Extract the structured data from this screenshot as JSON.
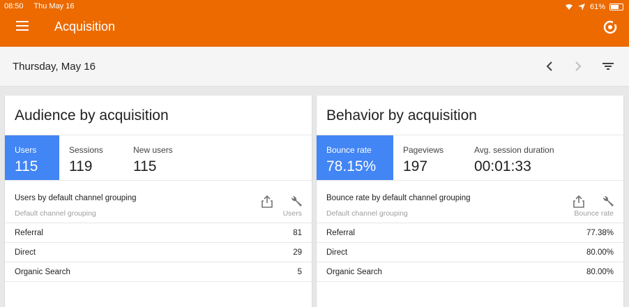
{
  "status": {
    "time": "08:50",
    "date": "Thu May 16",
    "battery": "61%"
  },
  "header": {
    "title": "Acquisition"
  },
  "datebar": {
    "date": "Thursday, May 16"
  },
  "cards": [
    {
      "title": "Audience by acquisition",
      "metrics": [
        {
          "label": "Users",
          "value": "115"
        },
        {
          "label": "Sessions",
          "value": "119"
        },
        {
          "label": "New users",
          "value": "115"
        }
      ],
      "table_title": "Users by default channel grouping",
      "dimension": "Default channel grouping",
      "metric_col": "Users",
      "rows": [
        {
          "k": "Referral",
          "v": "81"
        },
        {
          "k": "Direct",
          "v": "29"
        },
        {
          "k": "Organic Search",
          "v": "5"
        }
      ]
    },
    {
      "title": "Behavior by acquisition",
      "metrics": [
        {
          "label": "Bounce rate",
          "value": "78.15%"
        },
        {
          "label": "Pageviews",
          "value": "197"
        },
        {
          "label": "Avg. session duration",
          "value": "00:01:33"
        }
      ],
      "table_title": "Bounce rate by default channel grouping",
      "dimension": "Default channel grouping",
      "metric_col": "Bounce rate",
      "rows": [
        {
          "k": "Referral",
          "v": "77.38%"
        },
        {
          "k": "Direct",
          "v": "80.00%"
        },
        {
          "k": "Organic Search",
          "v": "80.00%"
        }
      ]
    }
  ],
  "colors": {
    "appbar": "#ec6a00",
    "selected_metric": "#4285f4"
  }
}
